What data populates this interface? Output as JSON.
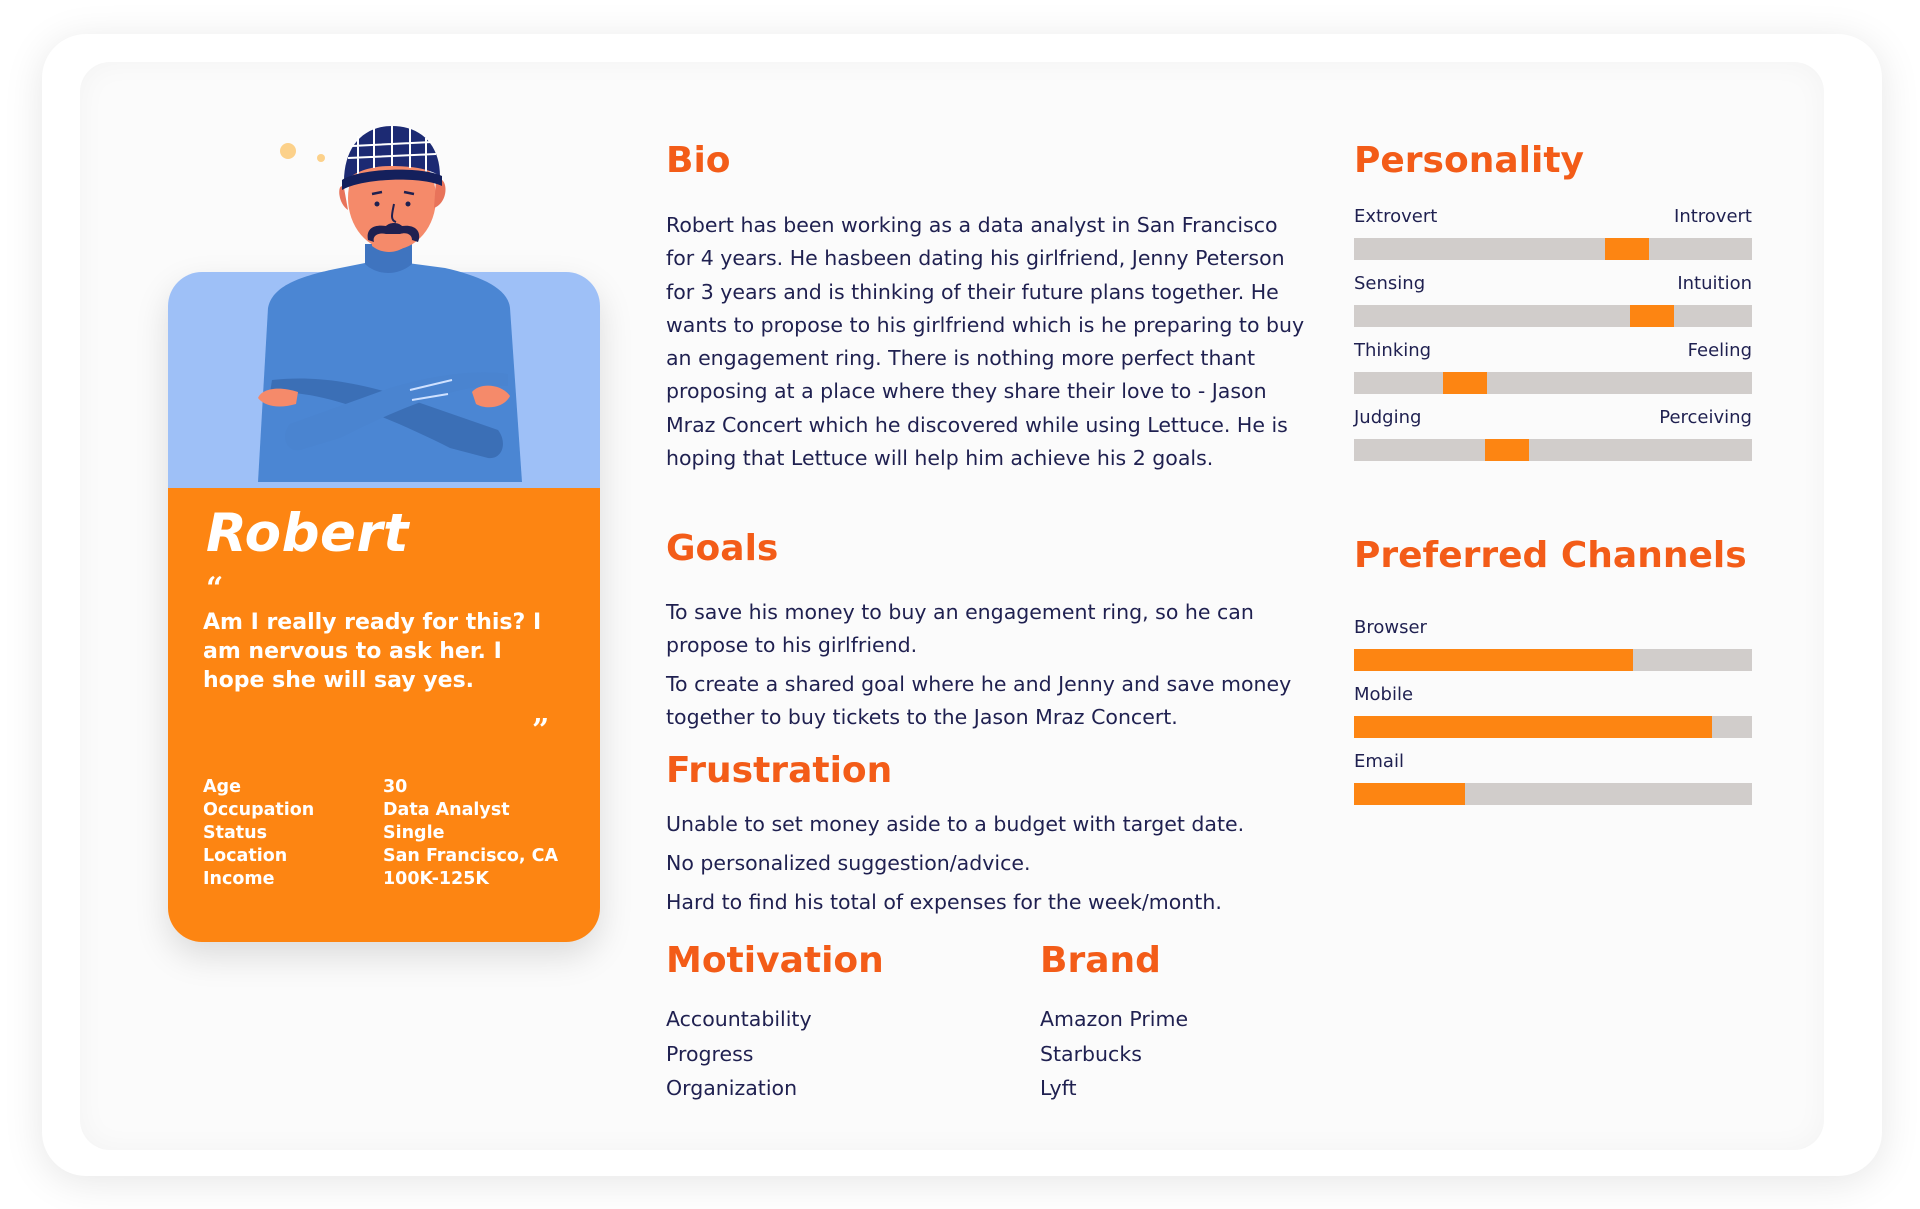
{
  "persona": {
    "name": "Robert",
    "quote_open": "“",
    "quote": "Am I really ready for this? I am nervous to ask her. I hope she will say yes.",
    "quote_close": "”",
    "facts": [
      {
        "label": "Age",
        "value": "30"
      },
      {
        "label": "Occupation",
        "value": "Data Analyst"
      },
      {
        "label": "Status",
        "value": "Single"
      },
      {
        "label": "Location",
        "value": "San Francisco, CA"
      },
      {
        "label": "Income",
        "value": "100K-125K"
      }
    ]
  },
  "bio": {
    "heading": "Bio",
    "text": "Robert has been working as a data analyst in San Francisco for 4 years. He hasbeen dating his girlfriend, Jenny Peterson for 3 years and is thinking of their future plans together. He wants to propose to his girlfriend which is he preparing to buy an engagement ring. There is nothing more perfect thant proposing at a place where they share their love to - Jason Mraz Concert which he discovered while using Lettuce. He is hoping that Lettuce will help him achieve his 2 goals."
  },
  "goals": {
    "heading": "Goals",
    "items": [
      "To save his money to buy an engagement ring, so he can propose to his girlfriend.",
      "To create a shared goal where he and Jenny and save money together to buy tickets to the Jason Mraz Concert."
    ]
  },
  "frustration": {
    "heading": "Frustration",
    "items": [
      "Unable to set money aside to a budget with target date.",
      "No personalized suggestion/advice.",
      "Hard to find his total of expenses for the week/month."
    ]
  },
  "motivation": {
    "heading": "Motivation",
    "items": [
      "Accountability",
      "Progress",
      "Organization"
    ]
  },
  "brand": {
    "heading": "Brand",
    "items": [
      "Amazon Prime",
      "Starbucks",
      "Lyft"
    ]
  },
  "personality": {
    "heading": "Personality",
    "scales": [
      {
        "left": "Extrovert",
        "right": "Introvert",
        "position": 0.71
      },
      {
        "left": "Sensing",
        "right": "Intuition",
        "position": 0.78
      },
      {
        "left": "Thinking",
        "right": "Feeling",
        "position": 0.25
      },
      {
        "left": "Judging",
        "right": "Perceiving",
        "position": 0.37
      }
    ]
  },
  "channels": {
    "heading": "Preferred Channels",
    "items": [
      {
        "label": "Browser",
        "level": 0.7
      },
      {
        "label": "Mobile",
        "level": 0.9
      },
      {
        "label": "Email",
        "level": 0.28
      }
    ]
  },
  "colors": {
    "accent": "#f35c18",
    "orange": "#fd8512",
    "card_blue": "#9ec0f7",
    "text": "#1f2050",
    "bar_track": "#d1cdcb"
  }
}
